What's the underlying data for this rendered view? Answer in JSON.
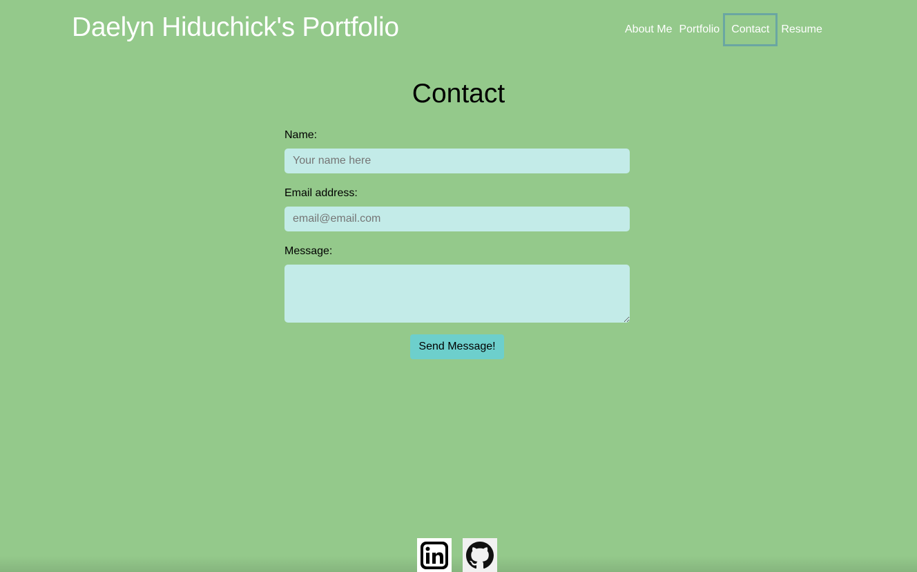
{
  "header": {
    "site_title": "Daelyn Hiduchick's Portfolio",
    "nav": [
      {
        "label": "About Me",
        "active": false
      },
      {
        "label": "Portfolio",
        "active": false
      },
      {
        "label": "Contact",
        "active": true
      },
      {
        "label": "Resume",
        "active": false
      }
    ]
  },
  "main": {
    "heading": "Contact",
    "form": {
      "name_label": "Name:",
      "name_placeholder": "Your name here",
      "email_label": "Email address:",
      "email_placeholder": "email@email.com",
      "message_label": "Message:",
      "message_value": "",
      "submit_label": "Send Message!"
    }
  },
  "footer": {
    "links": [
      {
        "icon": "linkedin-icon"
      },
      {
        "icon": "github-icon"
      }
    ]
  },
  "colors": {
    "background": "#94c98b",
    "input_bg": "#c3ebe8",
    "button_bg": "#6dcfcc",
    "active_nav_border": "#6aa6a2"
  }
}
